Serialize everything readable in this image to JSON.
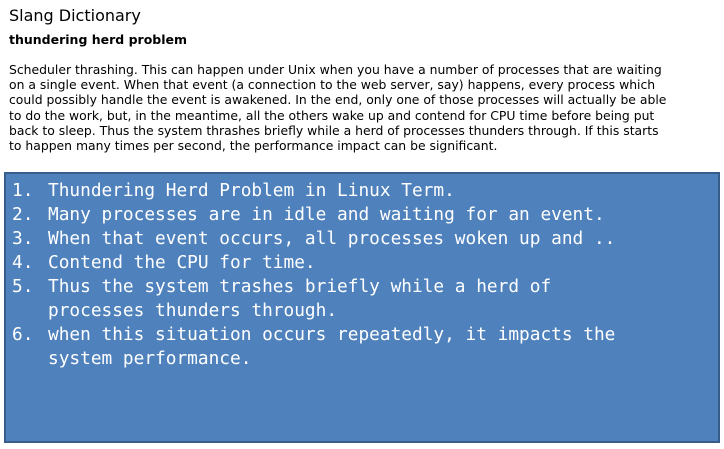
{
  "site": {
    "title": "Slang Dictionary"
  },
  "entry": {
    "term": "thundering herd problem",
    "definition_lines": [
      " Scheduler thrashing. This can happen under Unix when you have a number of processes that are waiting",
      "on a single event. When that event (a connection to the web server, say) happens, every process which",
      "could possibly handle the event is awakened. In the end, only one of those processes will actually be able",
      "to do the work, but, in the meantime, all the others wake up and contend for CPU time before being put",
      "back to sleep. Thus the system thrashes briefly while a herd of processes thunders through. If this starts",
      "to happen many times per second, the performance impact can be significant."
    ]
  },
  "notes": [
    {
      "num": "1.",
      "lines": [
        "Thundering Herd Problem in Linux Term."
      ]
    },
    {
      "num": "2.",
      "lines": [
        "Many processes are in idle and waiting for an event."
      ]
    },
    {
      "num": "3.",
      "lines": [
        "When that event occurs, all processes woken up and .."
      ]
    },
    {
      "num": "4.",
      "lines": [
        "Contend the CPU for time."
      ]
    },
    {
      "num": "5.",
      "lines": [
        "Thus the system trashes briefly while a herd of",
        "processes thunders through."
      ]
    },
    {
      "num": "6.",
      "lines": [
        "when this situation occurs repeatedly, it impacts the",
        "system performance."
      ]
    }
  ],
  "colors": {
    "panel_fill": "#4f81bd",
    "panel_border": "#385d8a",
    "panel_text": "#ffffff"
  }
}
